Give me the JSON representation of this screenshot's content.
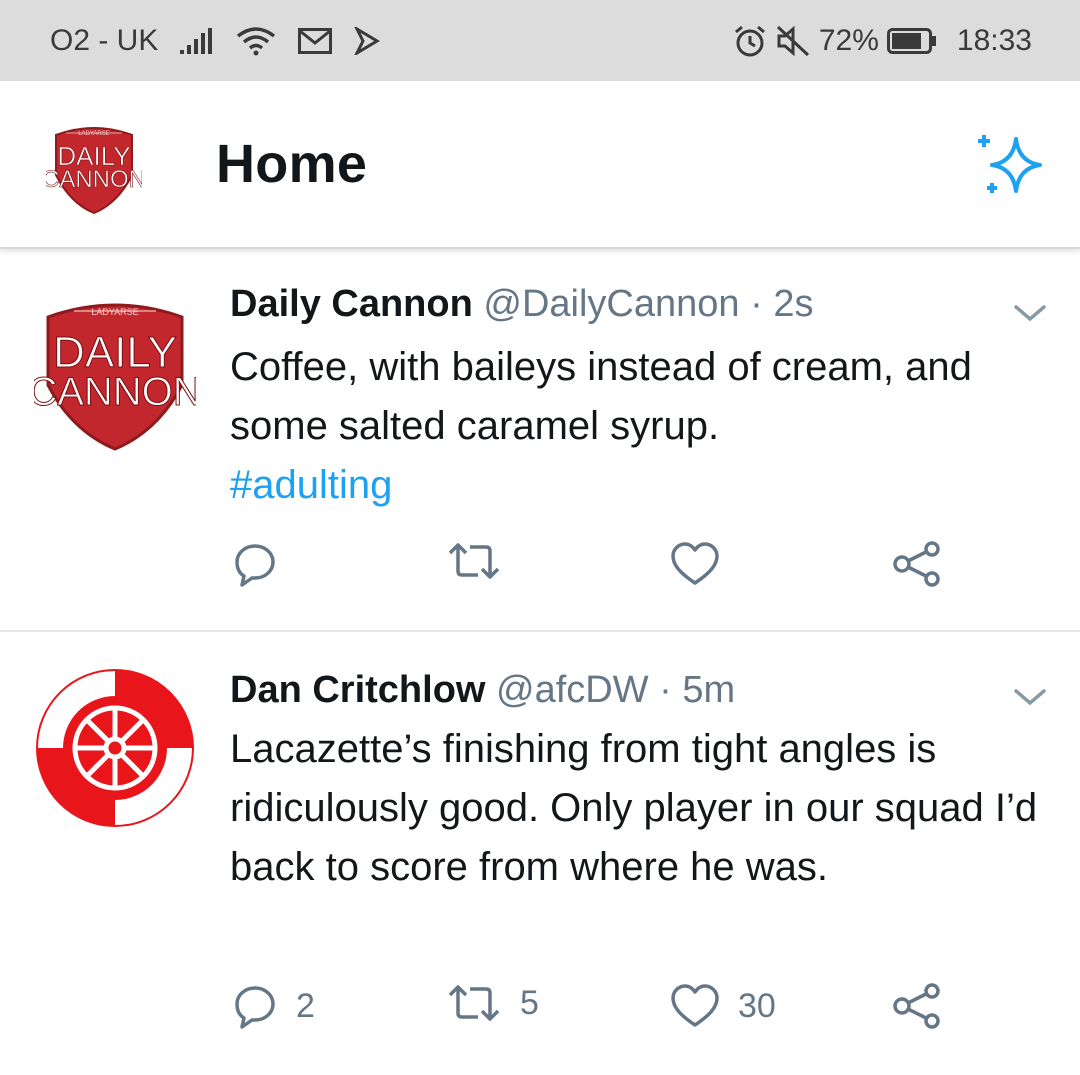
{
  "status_bar": {
    "carrier": "O2 - UK",
    "battery": "72%",
    "time": "18:33",
    "icons": [
      "signal-icon",
      "wifi-icon",
      "mail-icon",
      "notification-icon",
      "alarm-icon",
      "mute-icon",
      "battery-icon"
    ]
  },
  "header": {
    "title": "Home",
    "avatar_logo_text": [
      "LADYARSE",
      "DAILY",
      "CANNON"
    ],
    "sparkle_icon": "sparkle-icon"
  },
  "colors": {
    "accent": "#1da1f2",
    "text": "#14171a",
    "muted": "#657786",
    "logo_red": "#c1272d"
  },
  "tweets": [
    {
      "name": "Daily Cannon",
      "handle": "@DailyCannon",
      "sep": "·",
      "time": "2s",
      "text": "Coffee, with baileys instead of cream, and some salted caramel syrup.",
      "hashtag": "#adulting",
      "replies": "",
      "retweets": "",
      "likes": ""
    },
    {
      "name": "Dan Critchlow",
      "handle": "@afcDW",
      "sep": "·",
      "time": "5m",
      "text": "Lacazette’s finishing from tight angles is ridiculously good. Only player in our squad I’d back to score from where he was.",
      "replies": "2",
      "retweets": "5",
      "likes": "30"
    }
  ]
}
